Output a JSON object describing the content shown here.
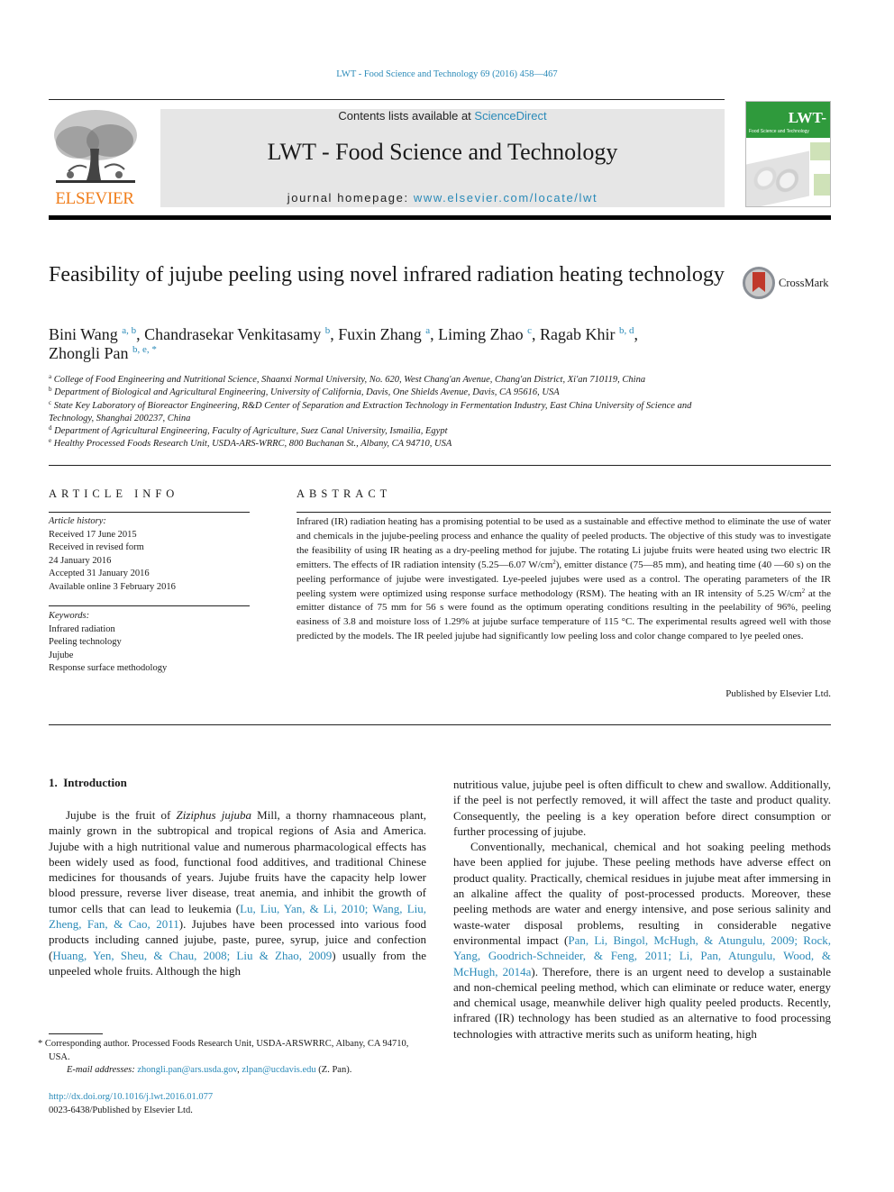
{
  "running_head": "LWT - Food Science and Technology 69 (2016) 458—467",
  "publisher_logo": {
    "word": "ELSEVIER",
    "icon": "elsevier-tree-icon"
  },
  "masthead": {
    "contents_prefix": "Contents lists available at ",
    "contents_link": "ScienceDirect",
    "journal_title": "LWT - Food Science and Technology",
    "homepage_prefix": "journal homepage: ",
    "homepage_link": "www.elsevier.com/locate/lwt"
  },
  "cover": {
    "title": "LWT-",
    "subtitle": "Food Science and Technology"
  },
  "crossmark": {
    "label": "CrossMark",
    "icon": "crossmark-icon"
  },
  "article": {
    "title": "Feasibility of jujube peeling using novel infrared radiation heating technology",
    "authors": [
      {
        "name": "Bini Wang",
        "sup": "a, b",
        "sep": ", "
      },
      {
        "name": "Chandrasekar Venkitasamy",
        "sup": "b",
        "sep": ", "
      },
      {
        "name": "Fuxin Zhang",
        "sup": "a",
        "sep": ", "
      },
      {
        "name": "Liming Zhao",
        "sup": "c",
        "sep": ", "
      },
      {
        "name": "Ragab Khir",
        "sup": "b, d",
        "sep": ","
      },
      {
        "name": "Zhongli Pan",
        "sup": "b, e, *",
        "sep": ""
      }
    ],
    "affiliations": [
      {
        "key": "a",
        "text": "College of Food Engineering and Nutritional Science, Shaanxi Normal University, No. 620, West Chang'an Avenue, Chang'an District, Xi'an 710119, China"
      },
      {
        "key": "b",
        "text": "Department of Biological and Agricultural Engineering, University of California, Davis, One Shields Avenue, Davis, CA 95616, USA"
      },
      {
        "key": "c",
        "text": "State Key Laboratory of Bioreactor Engineering, R&D Center of Separation and Extraction Technology in Fermentation Industry, East China University of Science and Technology, Shanghai 200237, China"
      },
      {
        "key": "d",
        "text": "Department of Agricultural Engineering, Faculty of Agriculture, Suez Canal University, Ismailia, Egypt"
      },
      {
        "key": "e",
        "text": "Healthy Processed Foods Research Unit, USDA-ARS-WRRC, 800 Buchanan St., Albany, CA 94710, USA"
      }
    ]
  },
  "article_info": {
    "heading": "ARTICLE INFO",
    "history_label": "Article history:",
    "history": [
      "Received 17 June 2015",
      "Received in revised form",
      "24 January 2016",
      "Accepted 31 January 2016",
      "Available online 3 February 2016"
    ],
    "keywords_label": "Keywords:",
    "keywords": [
      "Infrared radiation",
      "Peeling technology",
      "Jujube",
      "Response surface methodology"
    ]
  },
  "abstract": {
    "heading": "ABSTRACT",
    "part1": "Infrared (IR) radiation heating has a promising potential to be used as a sustainable and effective method to eliminate the use of water and chemicals in the jujube-peeling process and enhance the quality of peeled products. The objective of this study was to investigate the feasibility of using IR heating as a dry-peeling method for jujube. The rotating Li jujube fruits were heated using two electric IR emitters. The effects of IR radiation intensity (5.25—6.07 W/cm",
    "sup1": "2",
    "part2": "), emitter distance (75—85 mm), and heating time (40 —60 s) on the peeling performance of jujube were investigated. Lye-peeled jujubes were used as a control. The operating parameters of the IR peeling system were optimized using response surface methodology (RSM). The heating with an IR intensity of 5.25 W/cm",
    "sup2": "2",
    "part3": " at the emitter distance of 75 mm for 56 s were found as the optimum operating conditions resulting in the peelability of 96%, peeling easiness of 3.8 and moisture loss of 1.29% at jujube surface temperature of 115 °C. The experimental results agreed well with those predicted by the models. The IR peeled jujube had significantly low peeling loss and color change compared to lye peeled ones.",
    "published": "Published by Elsevier Ltd."
  },
  "introduction": {
    "heading": "1.  Introduction",
    "left": {
      "p1_a": "Jujube is the fruit of ",
      "p1_species": "Ziziphus jujuba",
      "p1_b": " Mill, a thorny rhamnaceous plant, mainly grown in the subtropical and tropical regions of Asia and America. Jujube with a high nutritional value and numerous pharmacological effects has been widely used as food, functional food additives, and traditional Chinese medicines for thousands of years. Jujube fruits have the capacity help lower blood pressure, reverse liver disease, treat anemia, and inhibit the growth of tumor cells that can lead to leukemia (",
      "cite1": "Lu, Liu, Yan, & Li, 2010; Wang, Liu, Zheng, Fan, & Cao, 2011",
      "p1_c": "). Jujubes have been processed into various food products including canned jujube, paste, puree, syrup, juice and confection (",
      "cite2": "Huang, Yen, Sheu, & Chau, 2008; Liu & Zhao, 2009",
      "p1_d": ") usually from the unpeeled whole fruits. Although the high"
    },
    "right": {
      "p1": "nutritious value, jujube peel is often difficult to chew and swallow. Additionally, if the peel is not perfectly removed, it will affect the taste and product quality. Consequently, the peeling is a key operation before direct consumption or further processing of jujube.",
      "p2_a": "Conventionally, mechanical, chemical and hot soaking peeling methods have been applied for jujube. These peeling methods have adverse effect on product quality. Practically, chemical residues in jujube meat after immersing in an alkaline affect the quality of post-processed products. Moreover, these peeling methods are water and energy intensive, and pose serious salinity and waste-water disposal problems, resulting in considerable negative environmental impact (",
      "cite3": "Pan, Li, Bingol, McHugh, & Atungulu, 2009; Rock, Yang, Goodrich-Schneider, & Feng, 2011; Li, Pan, Atungulu, Wood, & McHugh, 2014a",
      "p2_b": "). Therefore, there is an urgent need to develop a sustainable and non-chemical peeling method, which can eliminate or reduce water, energy and chemical usage, meanwhile deliver high quality peeled products. Recently, infrared (IR) technology has been studied as an alternative to food processing technologies with attractive merits such as uniform heating, high"
    }
  },
  "footnote": {
    "star": "*",
    "corresponding": " Corresponding author. Processed Foods Research Unit, USDA-ARSWRRC, Albany, CA 94710, USA.",
    "email_label": "E-mail addresses:",
    "email1": "zhongli.pan@ars.usda.gov",
    "email_sep": ", ",
    "email2": "zlpan@ucdavis.edu",
    "email_suffix": " (Z. Pan)."
  },
  "doi": {
    "link": "http://dx.doi.org/10.1016/j.lwt.2016.01.077",
    "issn": "0023-6438/Published by Elsevier Ltd."
  },
  "colors": {
    "link": "#2a8ab8",
    "elsevier_orange": "#f07d1a",
    "cover_green": "#2f9a3c",
    "masthead_bg": "#e6e6e6"
  }
}
